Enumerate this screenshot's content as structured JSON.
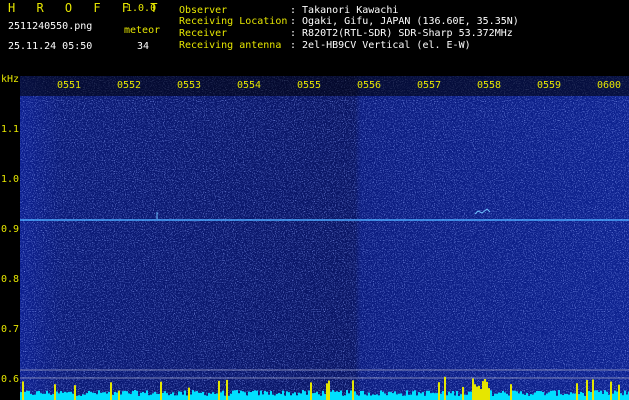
{
  "header": {
    "brand": "H R O F F T",
    "version": "1.0.0",
    "filename": "2511240550.png",
    "datetime": "25.11.24 05:50",
    "meteor_label": "meteor",
    "meteor_count": "34",
    "fields": [
      {
        "label": "Observer",
        "value": ": Takanori Kawachi"
      },
      {
        "label": "Receiving Location",
        "value": ": Ogaki, Gifu, JAPAN (136.60E, 35.35N)"
      },
      {
        "label": "Receiver",
        "value": ": R820T2(RTL-SDR) SDR-Sharp 53.372MHz"
      },
      {
        "label": "Receiving antenna",
        "value": ": 2el-HB9CV Vertical (el. E-W)"
      }
    ]
  },
  "axis": {
    "unit": "kHz",
    "y_ticks": [
      "1.1",
      "1.0",
      "0.9",
      "0.8",
      "0.7",
      "0.6"
    ],
    "x_ticks": [
      "0551",
      "0552",
      "0553",
      "0554",
      "0555",
      "0556",
      "0557",
      "0558",
      "0559",
      "0600"
    ]
  },
  "colors": {
    "background": "#000000",
    "label": "#e6e600",
    "value": "#ffffff",
    "spectrum": "#0a1a6e",
    "carrier": "#40a0ff",
    "noise_bar": "#00e0ff"
  }
}
